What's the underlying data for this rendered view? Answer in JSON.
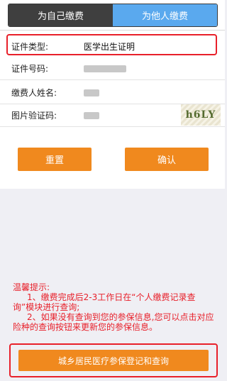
{
  "tabs": {
    "self": "为自己缴费",
    "other": "为他人缴费"
  },
  "form": {
    "cert_type_label": "证件类型:",
    "cert_type_value": "医学出生证明",
    "cert_no_label": "证件号码:",
    "payer_name_label": "缴费人姓名:",
    "captcha_label": "图片验证码:",
    "captcha_text": "h6LY"
  },
  "buttons": {
    "reset": "重置",
    "confirm": "确认",
    "query": "城乡居民医疗参保登记和查询"
  },
  "tips": {
    "title": "温馨提示:",
    "line1": "1、缴费完成后2-3工作日在“个人缴费记录查询”模块进行查询;",
    "line2": "2、如果没有查询到您的参保信息,您可以点击对应险种的查询按钮来更新您的参保信息。"
  },
  "colors": {
    "tab_active": "#5aa9ee",
    "tab_inactive": "#3f3f3f",
    "button": "#f0891e",
    "highlight": "#e8202a"
  }
}
